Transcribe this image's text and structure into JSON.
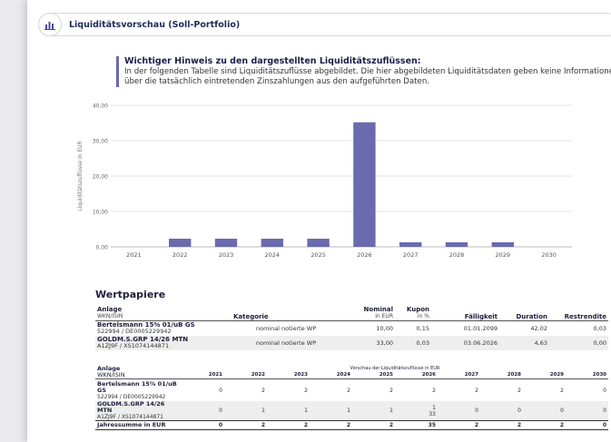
{
  "header": {
    "title": "Liquiditätsvorschau (Soll-Portfolio)"
  },
  "hint": {
    "title": "Wichtiger Hinweis zu den dargestellten Liquiditätszuflüssen:",
    "body": "In der folgenden Tabelle sind Liquiditätszuflüsse abgebildet. Die hier abgebildeten Liquiditätsdaten geben keine Informationen über die tatsächlich eintretenden Zinszahlungen aus den aufgeführten Daten."
  },
  "chart_data": {
    "type": "bar",
    "categories": [
      "2021",
      "2022",
      "2023",
      "2024",
      "2025",
      "2026",
      "2027",
      "2028",
      "2029",
      "2030"
    ],
    "values": [
      0,
      2.3,
      2.3,
      2.3,
      2.3,
      35.2,
      1.3,
      1.3,
      1.3,
      0
    ],
    "ylabel": "Liquiditätszuflüsse in EUR",
    "ylim": [
      0,
      40
    ],
    "yticks": [
      "0,00",
      "10,00",
      "20,00",
      "30,00",
      "40,00"
    ],
    "color": "#6a6aaf",
    "grid": true
  },
  "wertpapiere": {
    "title": "Wertpapiere",
    "headers": {
      "anlage": "Anlage",
      "wkn": "WKN/ISIN",
      "kategorie": "Kategorie",
      "nominal": "Nominal",
      "nominal_unit": "in EUR",
      "kupon": "Kupon",
      "kupon_unit": "in %",
      "faelligkeit": "Fälligkeit",
      "duration": "Duration",
      "rendite": "Restrendite"
    },
    "rows": [
      {
        "name": "Bertelsmann 15% 01/uB GS",
        "id": "522994 / DE0005229942",
        "kategorie": "nominal notierte WP",
        "nominal": "10,00",
        "kupon": "0,15",
        "faelligkeit": "01.01.2099",
        "duration": "42,02",
        "rendite": "0,03"
      },
      {
        "name": "GOLDM.S.GRP 14/26 MTN",
        "id": "A1ZJ9F / XS1074144871",
        "kategorie": "nominal notierte WP",
        "nominal": "33,00",
        "kupon": "0,03",
        "faelligkeit": "03.06.2026",
        "duration": "4,63",
        "rendite": "0,00"
      }
    ]
  },
  "vorschau": {
    "headers": {
      "anlage": "Anlage",
      "wkn": "WKN/ISIN",
      "group": "Verschau der Liquiditätszuflüsse in EUR"
    },
    "years": [
      "2021",
      "2022",
      "2023",
      "2024",
      "2025",
      "2026",
      "2027",
      "2028",
      "2029",
      "2030"
    ],
    "rows": [
      {
        "name": "Bertelsmann 15% 01/uB GS",
        "id": "522994 / DE0005229942",
        "values": [
          "0",
          "2",
          "2",
          "2",
          "2",
          "2",
          "2",
          "2",
          "2",
          "0"
        ]
      },
      {
        "name": "GOLDM.S.GRP 14/26 MTN",
        "id": "A1ZJ9F / XS1074144871",
        "values": [
          "0",
          "1",
          "1",
          "1",
          "1",
          "1",
          "0",
          "0",
          "0",
          "0"
        ],
        "extra_2026": "33"
      }
    ],
    "sum": {
      "label": "Jahressumme in EUR",
      "values": [
        "0",
        "2",
        "2",
        "2",
        "2",
        "35",
        "2",
        "2",
        "2",
        "0"
      ]
    }
  }
}
